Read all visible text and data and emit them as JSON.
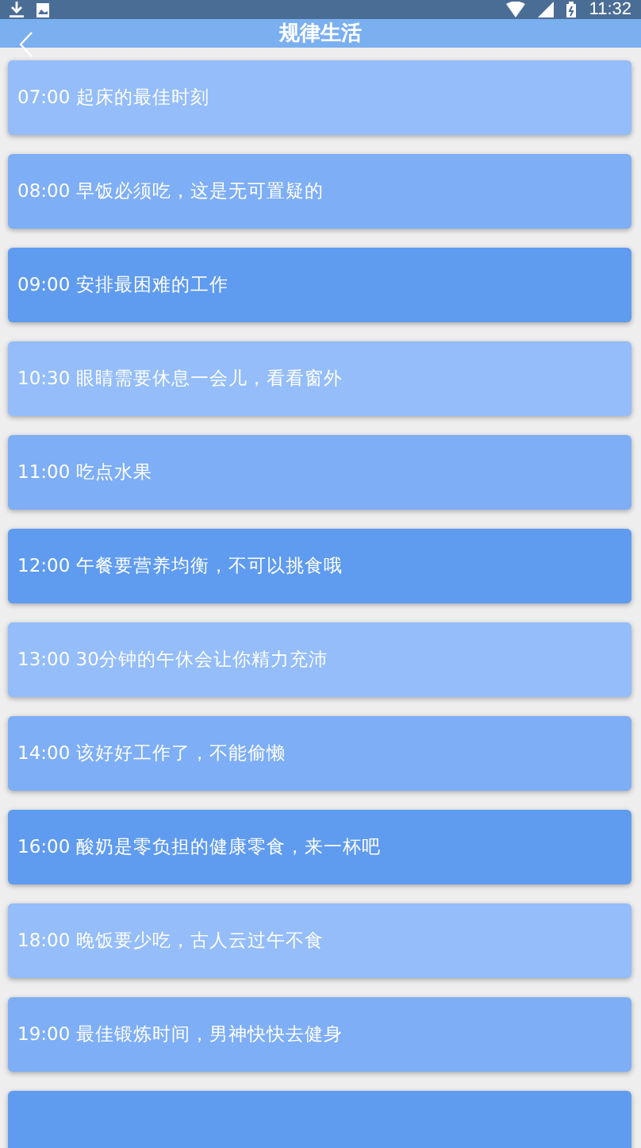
{
  "status_bar": {
    "time": "11:32"
  },
  "header": {
    "title": "规律生活"
  },
  "cards": [
    {
      "text": "07:00 起床的最佳时刻",
      "color": "#94bdf9"
    },
    {
      "text": "08:00 早饭必须吃，这是无可置疑的",
      "color": "#7eaef5"
    },
    {
      "text": "09:00 安排最困难的工作",
      "color": "#5f9bef"
    },
    {
      "text": "10:30 眼睛需要休息一会儿，看看窗外",
      "color": "#94bdf9"
    },
    {
      "text": "11:00 吃点水果",
      "color": "#7eaef5"
    },
    {
      "text": "12:00 午餐要营养均衡，不可以挑食哦",
      "color": "#5f9bef"
    },
    {
      "text": "13:00 30分钟的午休会让你精力充沛",
      "color": "#94bdf9"
    },
    {
      "text": "14:00 该好好工作了，不能偷懒",
      "color": "#7eaef5"
    },
    {
      "text": "16:00 酸奶是零负担的健康零食，来一杯吧",
      "color": "#5f9bef"
    },
    {
      "text": "18:00 晚饭要少吃，古人云过午不食",
      "color": "#94bdf9"
    },
    {
      "text": "19:00 最佳锻炼时间，男神快快去健身",
      "color": "#7eaef5"
    },
    {
      "color": "#5f9bef"
    }
  ]
}
